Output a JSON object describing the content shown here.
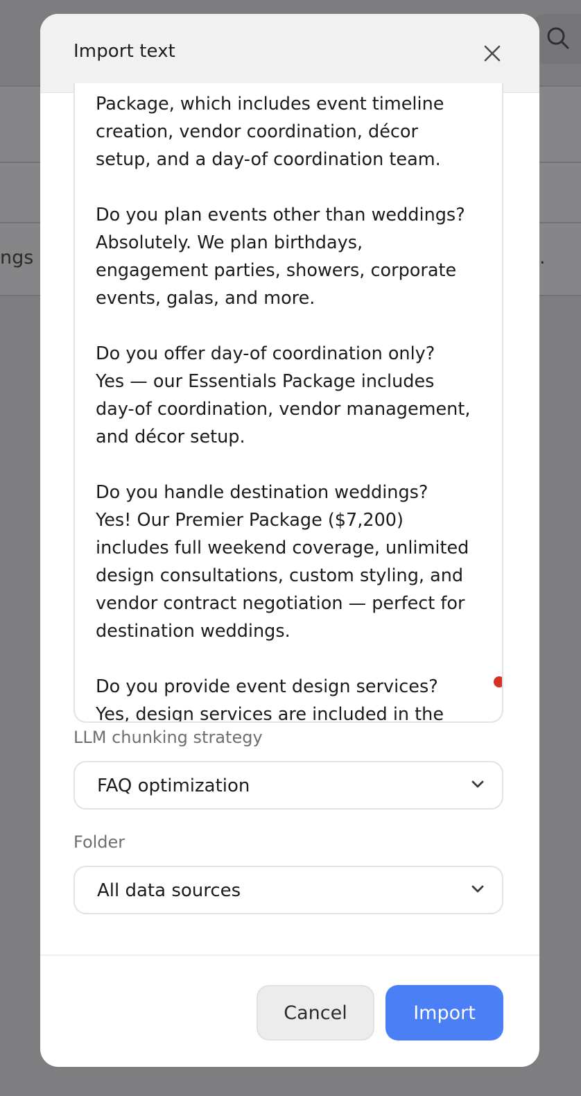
{
  "background": {
    "left_fragment": "ngs o",
    "right_fragment": "."
  },
  "modal": {
    "title": "Import text",
    "close_icon": "close-icon",
    "textarea": {
      "content": "Package, which includes event timeline\ncreation, vendor coordination, décor\nsetup, and a day-of coordination team.\n\nDo you plan events other than weddings?\nAbsolutely. We plan birthdays,\nengagement parties, showers, corporate\nevents, galas, and more.\n\nDo you offer day-of coordination only?\nYes — our Essentials Package includes\nday-of coordination, vendor management,\nand décor setup.\n\nDo you handle destination weddings?\nYes! Our Premier Package ($7,200)\nincludes full weekend coverage, unlimited\ndesign consultations, custom styling, and\nvendor contract negotiation — perfect for\ndestination weddings.\n\nDo you provide event design services?\nYes, design services are included in the"
    },
    "chunking": {
      "label": "LLM chunking strategy",
      "value": "FAQ optimization"
    },
    "folder": {
      "label": "Folder",
      "value": "All data sources"
    },
    "buttons": {
      "cancel": "Cancel",
      "import": "Import"
    }
  },
  "colors": {
    "accent": "#4b7ff5",
    "overlay": "#7e7e80",
    "error_dot": "#d93025"
  }
}
